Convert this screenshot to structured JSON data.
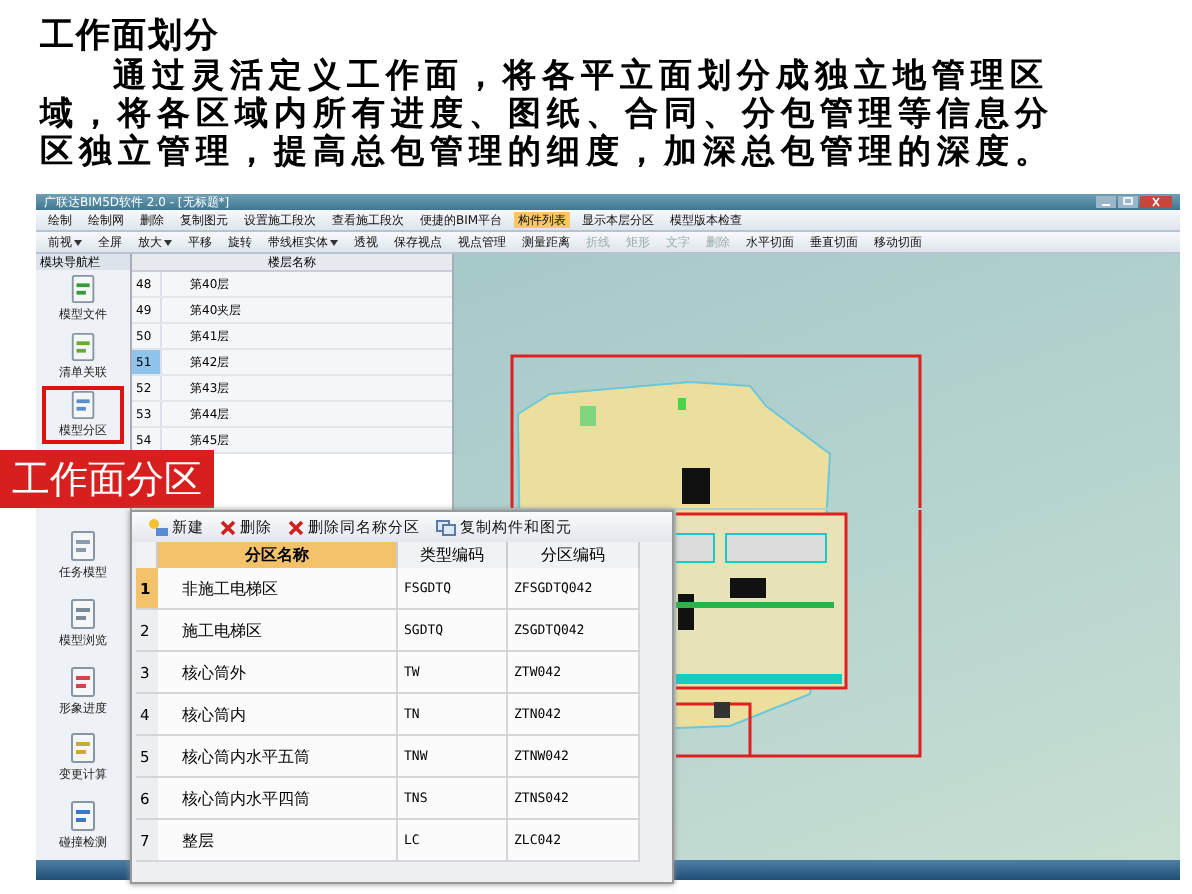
{
  "heading": "工作面划分",
  "paragraph": "通过灵活定义工作面，将各平立面划分成独立地管理区域，将各区域内所有进度、图纸、合同、分包管理等信息分区独立管理，提高总包管理的细度，加深总包管理的深度。",
  "window": {
    "title": "广联达BIM5D软件 2.0 - [无标题*]"
  },
  "toolbar_1": [
    {
      "label": "绘制",
      "selected": false
    },
    {
      "label": "绘制网",
      "selected": false
    },
    {
      "label": "删除",
      "selected": false
    },
    {
      "label": "复制图元",
      "selected": false
    },
    {
      "label": "设置施工段次",
      "selected": false
    },
    {
      "label": "查看施工段次",
      "selected": false
    },
    {
      "label": "便捷的BIM平台",
      "selected": false
    },
    {
      "label": "构件列表",
      "selected": true
    },
    {
      "label": "显示本层分区",
      "selected": false
    },
    {
      "label": "模型版本检查",
      "selected": false
    }
  ],
  "toolbar_2": [
    {
      "label": "前视",
      "dropdown": true,
      "disabled": false
    },
    {
      "label": "全屏",
      "dropdown": false,
      "disabled": false
    },
    {
      "label": "放大",
      "dropdown": true,
      "disabled": false
    },
    {
      "label": "平移",
      "dropdown": false,
      "disabled": false
    },
    {
      "label": "旋转",
      "dropdown": false,
      "disabled": false
    },
    {
      "label": "带线框实体",
      "dropdown": true,
      "disabled": false
    },
    {
      "label": "透视",
      "dropdown": false,
      "disabled": false
    },
    {
      "label": "保存视点",
      "dropdown": false,
      "disabled": false
    },
    {
      "label": "视点管理",
      "dropdown": false,
      "disabled": false
    },
    {
      "label": "测量距离",
      "dropdown": false,
      "disabled": false
    },
    {
      "label": "折线",
      "dropdown": false,
      "disabled": true
    },
    {
      "label": "矩形",
      "dropdown": false,
      "disabled": true
    },
    {
      "label": "文字",
      "dropdown": false,
      "disabled": true
    },
    {
      "label": "删除",
      "dropdown": false,
      "disabled": true
    },
    {
      "label": "水平切面",
      "dropdown": false,
      "disabled": false
    },
    {
      "label": "垂直切面",
      "dropdown": false,
      "disabled": false
    },
    {
      "label": "移动切面",
      "dropdown": false,
      "disabled": false
    }
  ],
  "sidebar": {
    "title": "模块导航栏",
    "items_top": [
      {
        "label": "模型文件",
        "selected": false
      },
      {
        "label": "清单关联",
        "selected": false
      },
      {
        "label": "模型分区",
        "selected": true
      }
    ],
    "items_bottom": [
      {
        "label": "任务模型",
        "selected": false
      },
      {
        "label": "模型浏览",
        "selected": false
      },
      {
        "label": "形象进度",
        "selected": false
      },
      {
        "label": "变更计算",
        "selected": false
      },
      {
        "label": "碰撞检测",
        "selected": false
      }
    ]
  },
  "floor_list": {
    "column": "楼层名称",
    "rows": [
      {
        "number": "48",
        "name": "第40层",
        "selected": false
      },
      {
        "number": "49",
        "name": "第40夹层",
        "selected": false
      },
      {
        "number": "50",
        "name": "第41层",
        "selected": false
      },
      {
        "number": "51",
        "name": "第42层",
        "selected": true
      },
      {
        "number": "52",
        "name": "第43层",
        "selected": false
      },
      {
        "number": "53",
        "name": "第44层",
        "selected": false
      },
      {
        "number": "54",
        "name": "第45层",
        "selected": false
      }
    ]
  },
  "callout": "工作面分区",
  "zone_dialog": {
    "actions": [
      {
        "kind": "new",
        "label": "新建"
      },
      {
        "kind": "delete",
        "label": "删除"
      },
      {
        "kind": "delete",
        "label": "删除同名称分区"
      },
      {
        "kind": "copy",
        "label": "复制构件和图元"
      }
    ],
    "columns": [
      "分区名称",
      "类型编码",
      "分区编码"
    ],
    "rows": [
      {
        "number": "1",
        "name": "非施工电梯区",
        "type_code": "FSGDTQ",
        "zone_code": "ZFSGDTQ042",
        "selected": true
      },
      {
        "number": "2",
        "name": "施工电梯区",
        "type_code": "SGDTQ",
        "zone_code": "ZSGDTQ042",
        "selected": false
      },
      {
        "number": "3",
        "name": "核心筒外",
        "type_code": "TW",
        "zone_code": "ZTW042",
        "selected": false
      },
      {
        "number": "4",
        "name": "核心筒内",
        "type_code": "TN",
        "zone_code": "ZTN042",
        "selected": false
      },
      {
        "number": "5",
        "name": "核心筒内水平五筒",
        "type_code": "TNW",
        "zone_code": "ZTNW042",
        "selected": false
      },
      {
        "number": "6",
        "name": "核心筒内水平四筒",
        "type_code": "TNS",
        "zone_code": "ZTNS042",
        "selected": false
      },
      {
        "number": "7",
        "name": "整层",
        "type_code": "LC",
        "zone_code": "ZLC042",
        "selected": false
      }
    ]
  }
}
